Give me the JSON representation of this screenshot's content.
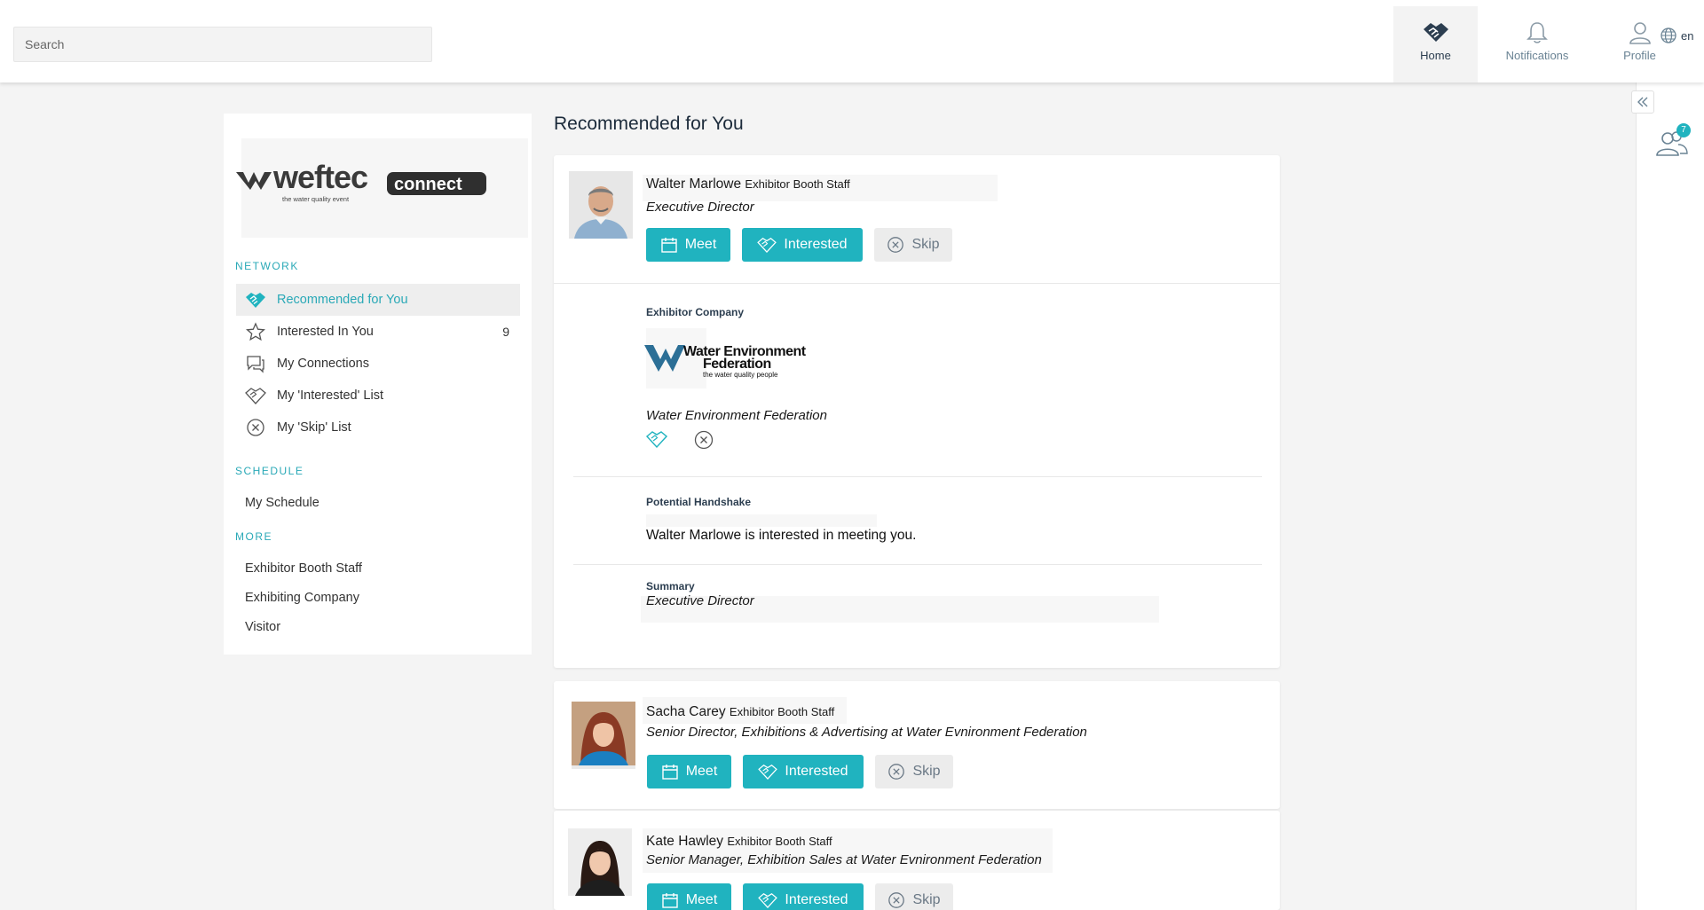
{
  "topbar": {
    "search_placeholder": "Search",
    "nav": {
      "home": "Home",
      "notifications": "Notifications",
      "profile": "Profile"
    },
    "language": "en"
  },
  "sidebar": {
    "logo": {
      "text": "weftec",
      "sub": "the water quality event",
      "badge": "connect"
    },
    "network_title": "NETWORK",
    "network_items": [
      {
        "label": "Recommended for You",
        "icon": "handshake-icon",
        "active": true
      },
      {
        "label": "Interested In You",
        "icon": "star-icon",
        "count": "9"
      },
      {
        "label": "My Connections",
        "icon": "chat-icon"
      },
      {
        "label": "My 'Interested' List",
        "icon": "handshake-outline-icon"
      },
      {
        "label": "My 'Skip' List",
        "icon": "skip-circle-icon"
      }
    ],
    "schedule_title": "SCHEDULE",
    "schedule_items": [
      {
        "label": "My Schedule"
      }
    ],
    "more_title": "MORE",
    "more_items": [
      {
        "label": "Exhibitor Booth Staff"
      },
      {
        "label": "Exhibiting Company"
      },
      {
        "label": "Visitor"
      }
    ]
  },
  "main": {
    "title": "Recommended for You",
    "buttons": {
      "meet": "Meet",
      "interested": "Interested",
      "skip": "Skip"
    },
    "featured": {
      "name": "Walter Marlowe",
      "role": "Exhibitor Booth Staff",
      "title": "Executive Director",
      "company_label": "Exhibitor Company",
      "company_logo": {
        "line1": "Water Environment",
        "line2": "Federation",
        "tagline": "the water quality people"
      },
      "company_name": "Water Environment Federation",
      "handshake_label": "Potential Handshake",
      "handshake_text": "Walter Marlowe is interested in meeting you.",
      "summary_label": "Summary",
      "summary_text": "Executive Director"
    },
    "people": [
      {
        "name": "Sacha Carey",
        "role": "Exhibitor Booth Staff",
        "title": "Senior Director, Exhibitions & Advertising at Water Evnironment Federation"
      },
      {
        "name": "Kate Hawley",
        "role": "Exhibitor Booth Staff",
        "title": "Senior Manager, Exhibition Sales at Water Evnironment Federation"
      }
    ]
  },
  "rail": {
    "badge_count": "7"
  },
  "colors": {
    "accent": "#20b3bf",
    "skip_bg": "#ececec",
    "page_bg": "#f4f4f4"
  }
}
